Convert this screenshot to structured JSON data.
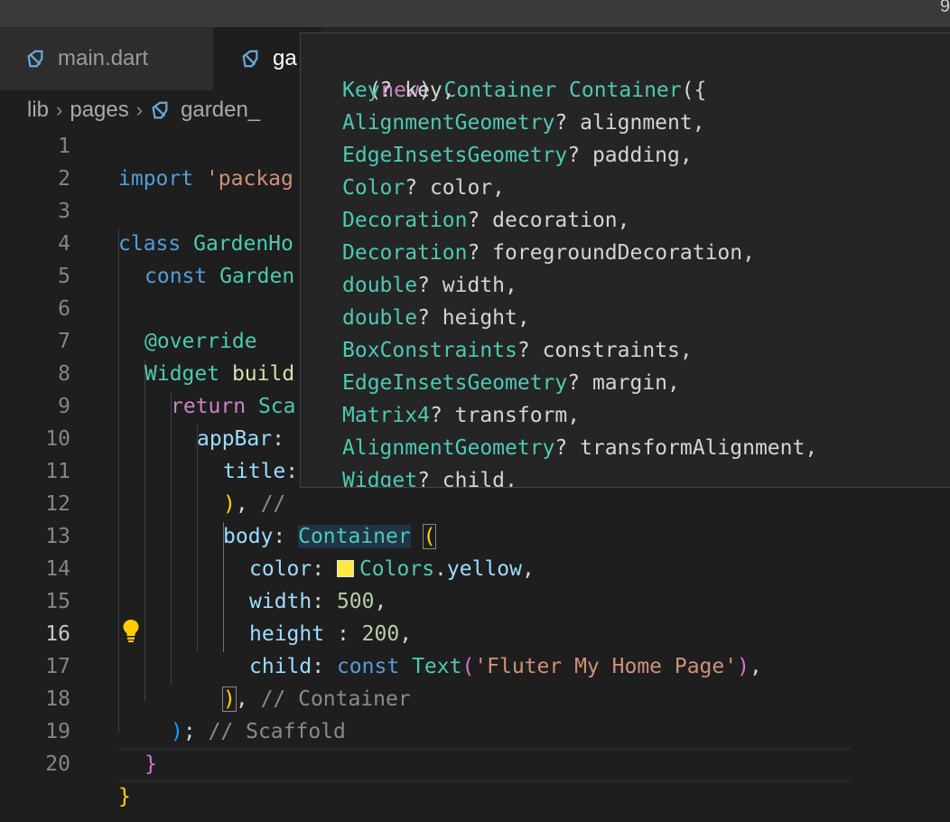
{
  "titlebar": {
    "corner_text": "9"
  },
  "tabs": [
    {
      "label": "main.dart",
      "icon": "dart-file-icon",
      "active": false
    },
    {
      "label": "ga",
      "icon": "dart-file-icon",
      "active": true
    }
  ],
  "breadcrumb": {
    "seg1": "lib",
    "seg2": "pages",
    "seg3": "garden_",
    "sep": "›"
  },
  "current_line": 16,
  "colors": {
    "swatch": "#ffeb3b",
    "keyword": "#569cd6",
    "type": "#4ec9b0",
    "string": "#ce9178"
  },
  "code": {
    "l1": {
      "a": "import",
      "b": " 'packag"
    },
    "l3": {
      "a": "class",
      "b": " GardenHo"
    },
    "l4": {
      "a": "const",
      "b": " Garden"
    },
    "l6": {
      "a": "@override"
    },
    "l7": {
      "a": "Widget",
      "b": " build"
    },
    "l8": {
      "a": "return",
      "b": " Sca"
    },
    "l9": {
      "a": "appBar",
      "b": ":"
    },
    "l10": {
      "a": "title",
      "b": ":"
    },
    "l11": {
      "a": ")",
      "b": ", ",
      "c": "//"
    },
    "l12": {
      "a": "body",
      "b": ": ",
      "c": "Container",
      "d": " ",
      "e": "("
    },
    "l13": {
      "a": "color",
      "b": ": ",
      "c": "Colors",
      "d": ".",
      "e": "yellow",
      "f": ","
    },
    "l14": {
      "a": "width",
      "b": ": ",
      "c": "500",
      "d": ","
    },
    "l15": {
      "a": "height",
      "b": " : ",
      "c": "200",
      "d": ","
    },
    "l16": {
      "a": "child",
      "b": ": ",
      "c": "const",
      "d": " ",
      "e": "Text",
      "f": "(",
      "g": "'Fluter My Home Page'",
      "h": ")",
      "i": ","
    },
    "l17": {
      "a": ")",
      "b": ", ",
      "c": "// Container"
    },
    "l18": {
      "a": ")",
      "b": "; ",
      "c": "// Scaffold"
    },
    "l19": {
      "a": "}"
    },
    "l20": {
      "a": "}"
    }
  },
  "popup": {
    "header": {
      "open": "(",
      "kw": "new",
      "close": ")",
      "t1": "Container",
      "t2": "Container",
      "tail": "({"
    },
    "params": [
      {
        "type": "Key",
        "rest": "? key,"
      },
      {
        "type": "AlignmentGeometry",
        "rest": "? alignment,"
      },
      {
        "type": "EdgeInsetsGeometry",
        "rest": "? padding,"
      },
      {
        "type": "Color",
        "rest": "? color,"
      },
      {
        "type": "Decoration",
        "rest": "? decoration,"
      },
      {
        "type": "Decoration",
        "rest": "? foregroundDecoration,"
      },
      {
        "type": "double",
        "rest": "? width,"
      },
      {
        "type": "double",
        "rest": "? height,"
      },
      {
        "type": "BoxConstraints",
        "rest": "? constraints,"
      },
      {
        "type": "EdgeInsetsGeometry",
        "rest": "? margin,"
      },
      {
        "type": "Matrix4",
        "rest": "? transform,"
      },
      {
        "type": "AlignmentGeometry",
        "rest": "? transformAlignment,"
      },
      {
        "type": "Widget",
        "rest": "? child,"
      }
    ]
  }
}
